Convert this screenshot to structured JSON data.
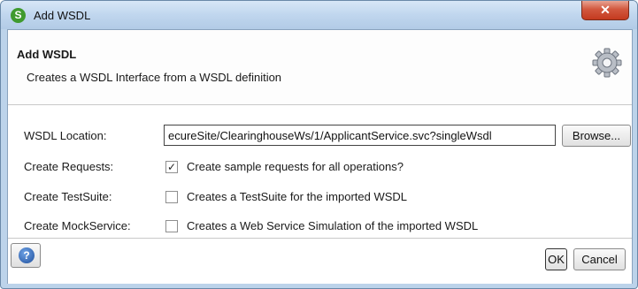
{
  "window": {
    "title": "Add WSDL",
    "app_icon": "S",
    "close_glyph": "✕"
  },
  "header": {
    "title": "Add WSDL",
    "description": "Creates a WSDL Interface from a WSDL definition",
    "icon": "gear-icon"
  },
  "form": {
    "wsdl_location": {
      "label": "WSDL Location:",
      "value": "ecureSite/ClearinghouseWs/1/ApplicantService.svc?singleWsdl",
      "browse_label": "Browse..."
    },
    "create_requests": {
      "label": "Create Requests:",
      "checked": true,
      "text": "Create sample requests for all operations?"
    },
    "create_testsuite": {
      "label": "Create TestSuite:",
      "checked": false,
      "text": "Creates a TestSuite for the imported WSDL"
    },
    "create_mockservice": {
      "label": "Create MockService:",
      "checked": false,
      "text": "Creates a Web Service Simulation of the imported WSDL"
    }
  },
  "footer": {
    "help_icon": "help-icon",
    "help_glyph": "?",
    "ok_label": "OK",
    "cancel_label": "Cancel"
  }
}
